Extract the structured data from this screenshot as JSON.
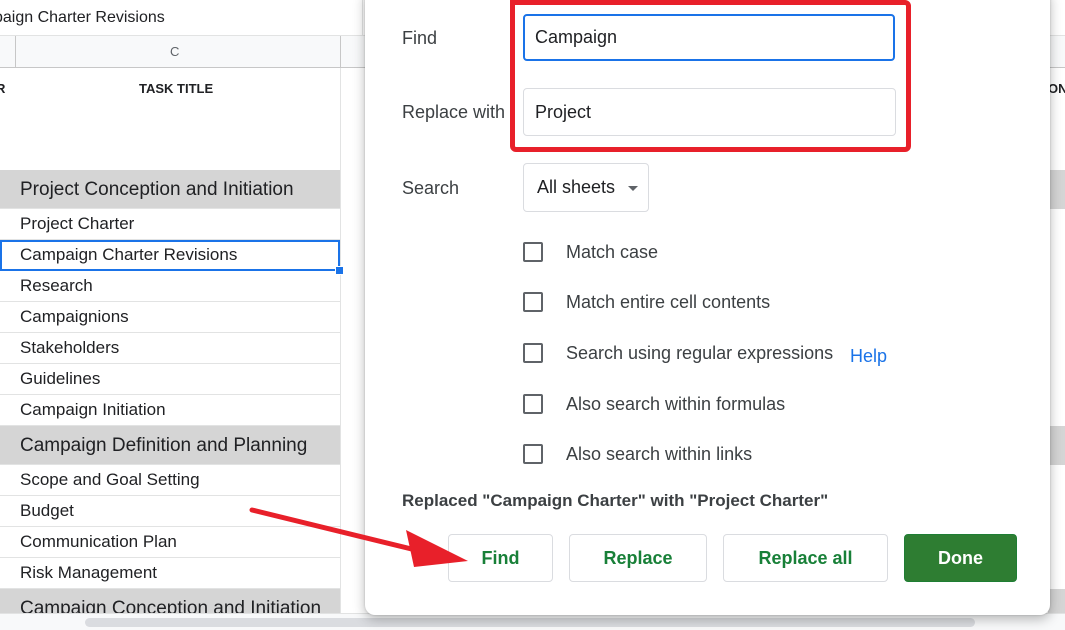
{
  "sheet": {
    "formula_bar_text": "paign Charter Revisions",
    "column_label": "C",
    "left_header_fragment": "R",
    "task_title_header": "TASK TITLE",
    "right_header_fragment": "ON",
    "rows": [
      {
        "text": "Project Conception and Initiation",
        "kind": "section"
      },
      {
        "text": "Project Charter",
        "kind": "item"
      },
      {
        "text": "Campaign Charter Revisions",
        "kind": "item",
        "selected": true
      },
      {
        "text": "Research",
        "kind": "item"
      },
      {
        "text": "Campaignions",
        "kind": "item"
      },
      {
        "text": "Stakeholders",
        "kind": "item"
      },
      {
        "text": "Guidelines",
        "kind": "item"
      },
      {
        "text": "Campaign Initiation",
        "kind": "item"
      },
      {
        "text": "Campaign Definition and Planning",
        "kind": "section"
      },
      {
        "text": "Scope and Goal Setting",
        "kind": "item"
      },
      {
        "text": "Budget",
        "kind": "item"
      },
      {
        "text": "Communication Plan",
        "kind": "item"
      },
      {
        "text": "Risk Management",
        "kind": "item"
      },
      {
        "text": "Campaign Conception and Initiation",
        "kind": "section"
      }
    ]
  },
  "dialog": {
    "find_label": "Find",
    "find_value": "Campaign",
    "replace_label": "Replace with",
    "replace_value": "Project",
    "search_label": "Search",
    "search_scope": "All sheets",
    "options": [
      {
        "label": "Match case",
        "checked": false
      },
      {
        "label": "Match entire cell contents",
        "checked": false
      },
      {
        "label": "Search using regular expressions",
        "checked": false
      },
      {
        "label": "Also search within formulas",
        "checked": false
      },
      {
        "label": "Also search within links",
        "checked": false
      }
    ],
    "help_link": "Help",
    "status_message": "Replaced \"Campaign Charter\" with \"Project Charter\"",
    "buttons": {
      "find": "Find",
      "replace": "Replace",
      "replace_all": "Replace all",
      "done": "Done"
    }
  },
  "colors": {
    "accent_blue": "#1a73e8",
    "green_text": "#188038",
    "done_green": "#2e7d32",
    "annotation_red": "#e8202a",
    "section_gray": "#d5d5d5"
  },
  "annotations": {
    "highlight_box": "red-rectangle",
    "pointer": "red-arrow"
  }
}
